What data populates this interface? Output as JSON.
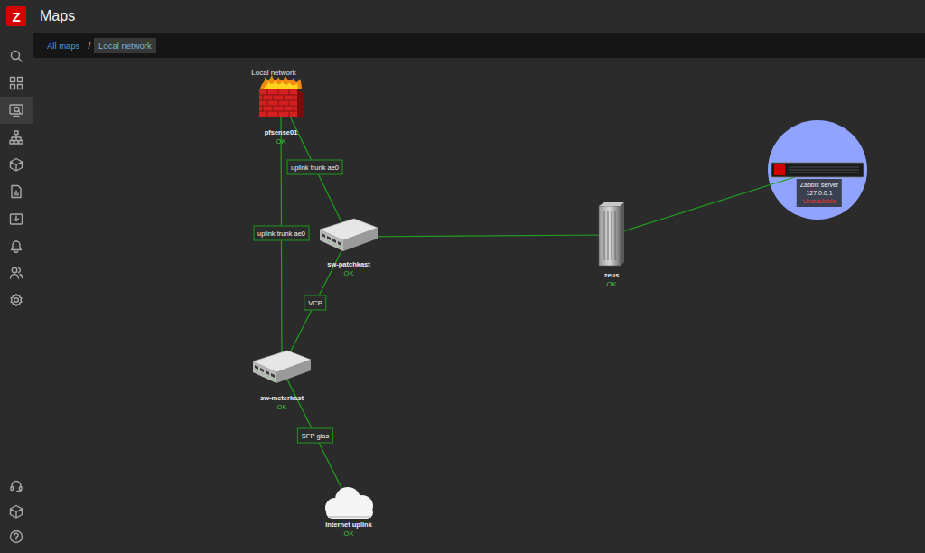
{
  "header": {
    "title": "Maps"
  },
  "sidebar": {
    "logo": "Z",
    "items": [
      {
        "selected": false
      },
      {
        "selected": false
      },
      {
        "selected": true
      },
      {
        "selected": false
      },
      {
        "selected": false
      },
      {
        "selected": false
      },
      {
        "selected": false
      },
      {
        "selected": false
      },
      {
        "selected": false
      },
      {
        "selected": false
      }
    ],
    "footer_items": [
      {
        "selected": false
      },
      {
        "selected": false
      },
      {
        "selected": false
      }
    ]
  },
  "breadcrumbs": [
    {
      "label": "All maps",
      "selected": false
    },
    {
      "label": "Local network",
      "selected": true
    }
  ],
  "breadcrumb_separator": "/",
  "map": {
    "elements": [
      {
        "kind": "firewall",
        "label": "Local network",
        "name": "pfsense01",
        "status": "OK",
        "color": "#3cc43c",
        "highlighted": false
      },
      {
        "kind": "switch",
        "name": "sw-patchkast",
        "status": "OK",
        "color": "#3cc43c",
        "highlighted": false
      },
      {
        "kind": "server",
        "name": "zeus",
        "status": "OK",
        "color": "#3cc43c",
        "highlighted": false
      },
      {
        "kind": "appliance",
        "name": "Zabbix server",
        "address": "127.0.0.1",
        "status": "Unavailable",
        "color": "#e33734",
        "highlighted": true
      },
      {
        "kind": "switch",
        "name": "sw-meterkast",
        "status": "OK",
        "color": "#3cc43c",
        "highlighted": false
      },
      {
        "kind": "cloud",
        "name": "internet uplink",
        "status": "OK",
        "color": "#3cc43c",
        "highlighted": false
      }
    ],
    "links": [
      {
        "from": "pfsense01",
        "to": "sw-patchkast",
        "label": "uplink trunk ae0"
      },
      {
        "from": "pfsense01",
        "to": "sw-meterkast",
        "label": "uplink trunk ae0"
      },
      {
        "from": "sw-patchkast",
        "to": "sw-meterkast",
        "label": "VCP"
      },
      {
        "from": "sw-patchkast",
        "to": "zeus"
      },
      {
        "from": "zeus",
        "to": "Zabbix server"
      },
      {
        "from": "sw-meterkast",
        "to": "internet uplink",
        "label": "SFP glas"
      }
    ]
  }
}
